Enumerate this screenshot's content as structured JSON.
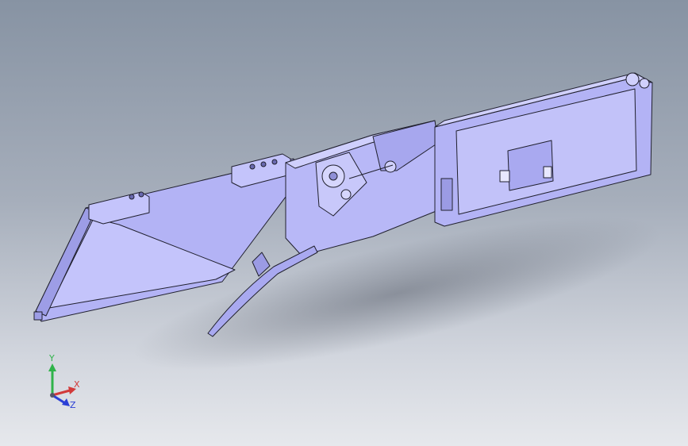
{
  "viewport": {
    "model": "tape-feeder-assembly",
    "background_top": "#8793a3",
    "background_bottom": "#e6e8ec",
    "part_fill": "#b3b3f5",
    "part_fill_light": "#c8c8fa",
    "part_fill_dark": "#8f8fd6",
    "edge_color": "#20202e"
  },
  "triad": {
    "x_label": "X",
    "y_label": "Y",
    "z_label": "Z",
    "x_color": "#d23a3a",
    "y_color": "#2fb34a",
    "z_color": "#2b3fd6"
  }
}
